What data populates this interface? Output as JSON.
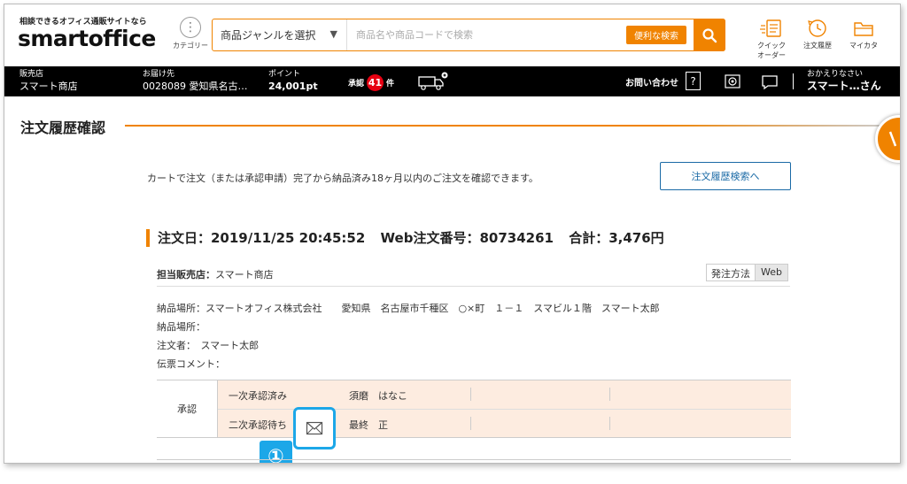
{
  "header": {
    "tagline": "相談できるオフィス通販サイトなら",
    "logo": "smartoffice",
    "category_label": "カテゴリー",
    "genre_select": "商品ジャンルを選択",
    "search_placeholder": "商品名や商品コードで検索",
    "convenient_search": "便利な検索",
    "icons": [
      {
        "name": "quick-order",
        "label_line1": "クイック",
        "label_line2": "オーダー"
      },
      {
        "name": "order-history",
        "label_line1": "注文履歴",
        "label_line2": ""
      },
      {
        "name": "my-catalog",
        "label_line1": "マイカタ",
        "label_line2": ""
      }
    ]
  },
  "bar": {
    "store_label": "販売店",
    "store_value": "スマート商店",
    "delivery_label": "お届け先",
    "delivery_value": "0028089 愛知県名古…",
    "points_label": "ポイント",
    "points_value": "24,001pt",
    "approval_prefix": "承認",
    "approval_count": "41",
    "approval_suffix": "件",
    "contact": "お問い合わせ",
    "contact_icon_glyph": "?",
    "greeting_line1": "おかえりなさい",
    "greeting_line2": "スマート…さん"
  },
  "page": {
    "title": "注文履歴確認",
    "description": "カートで注文（または承認申請）完了から納品済み18ヶ月以内のご注文を確認できます。",
    "history_search_button": "注文履歴検索へ"
  },
  "order": {
    "date": "注文日：2019/11/25 20:45:52",
    "web_number": "Web注文番号：80734261",
    "total": "合計：3,476円",
    "shop_label": "担当販売店：",
    "shop_value": "スマート商店",
    "method_label": "発注方法",
    "method_value": "Web",
    "delivery_place": "納品場所：スマートオフィス株式会社　　愛知県　名古屋市千種区　○×町　１－１　スマビル１階　スマート太郎",
    "delivery_place2": "納品場所：",
    "orderer": "注文者：　スマート太郎",
    "slip_comment": "伝票コメント："
  },
  "approval": {
    "header": "承認",
    "rows": [
      {
        "status": "一次承認済み",
        "person": "須磨　はなこ"
      },
      {
        "status": "二次承認待ち",
        "person": "最終　正"
      }
    ]
  },
  "callout": {
    "number": "①"
  },
  "colors": {
    "accent": "#f08300",
    "highlight": "#1ca7e8",
    "approval_bg": "#fdece0",
    "badge_red": "#e60012"
  }
}
